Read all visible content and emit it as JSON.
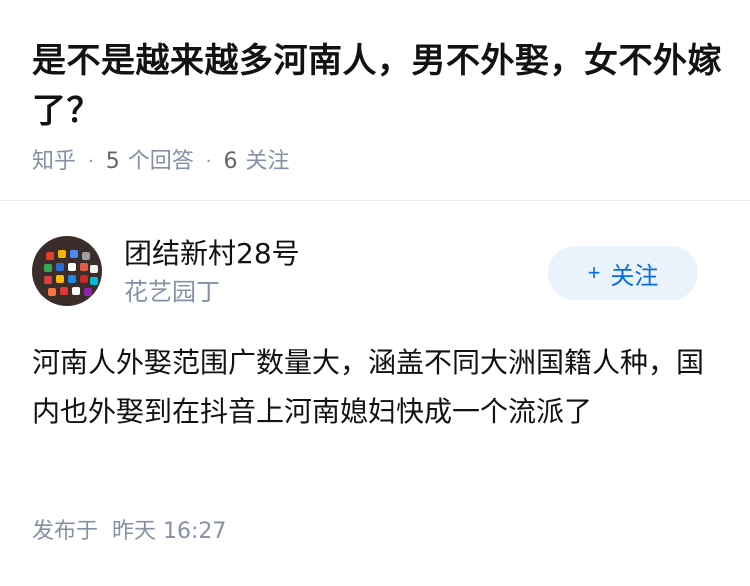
{
  "question": {
    "title": "是不是越来越多河南人，男不外娶，女不外嫁了？",
    "source": "知乎",
    "answers_count": "5",
    "answers_label": "个回答",
    "followers_count": "6",
    "followers_label": "关注"
  },
  "author": {
    "name": "团结新村28号",
    "tagline": "花艺园丁",
    "follow_label": "关注",
    "follow_icon": "plus-icon"
  },
  "answer": {
    "content": "河南人外娶范围广数量大，涵盖不同大洲国籍人种，国内也外娶到在抖音上河南媳妇快成一个流派了",
    "published_label": "发布于",
    "published_time": "昨天 16:27"
  },
  "colors": {
    "accent": "#056de8",
    "accent_bg": "#eaf2fc",
    "meta": "#8590a6",
    "text": "#121212"
  }
}
